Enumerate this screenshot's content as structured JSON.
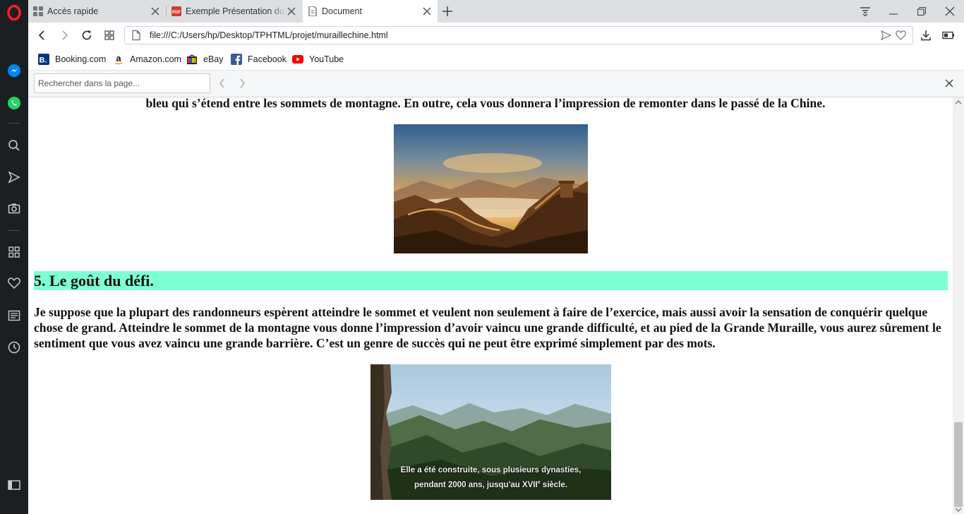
{
  "tabs": [
    {
      "title": "Accès rapide",
      "icon": "grid-icon"
    },
    {
      "title": "Exemple Présentation du p",
      "icon": "pdf-icon"
    },
    {
      "title": "Document",
      "icon": "document-icon",
      "active": true
    }
  ],
  "address": {
    "url": "file:///C:/Users/hp/Desktop/TPHTML/projet/muraillechine.html"
  },
  "bookmarks": [
    {
      "label": "Booking.com",
      "icon": "booking-icon",
      "color": "#003580"
    },
    {
      "label": "Amazon.com",
      "icon": "amazon-icon",
      "color": "#111111"
    },
    {
      "label": "eBay",
      "icon": "ebay-icon",
      "color": "#e53238"
    },
    {
      "label": "Facebook",
      "icon": "facebook-icon",
      "color": "#3b5998"
    },
    {
      "label": "YouTube",
      "icon": "youtube-icon",
      "color": "#ff0000"
    }
  ],
  "find": {
    "placeholder": "Rechercher dans la page..."
  },
  "sidebar": {
    "items": [
      "opera-logo-icon",
      "messenger-icon",
      "whatsapp-icon",
      "search-icon",
      "send-icon",
      "camera-icon",
      "speed-dial-icon",
      "heart-icon",
      "news-icon",
      "history-icon",
      "sidebar-toggle-icon"
    ]
  },
  "page": {
    "intro_text": "bleu qui s’étend entre les sommets de montagne. En outre, cela vous donnera l’impression de remonter dans le passé de la Chine.",
    "heading": "5. Le goût du défi.",
    "body_text": "Je suppose que la plupart des randonneurs espèrent atteindre le sommet et veulent non seulement à faire de l’exercice, mais aussi avoir la sensation de conquérir quelque chose de grand. Atteindre le sommet de la montagne vous donne l’impression d’avoir vaincu une grande difficulté, et au pied de la Grande Muraille, vous aurez sûrement le sentiment que vous avez vaincu une grande barrière. C’est un genre de succès qui ne peut être exprimé simplement par des mots.",
    "caption_line1": "Elle a été construite, sous plusieurs dynasties,",
    "caption_line2": "pendant 2000 ans, jusqu'au XVII",
    "caption_sup": "e",
    "caption_end": "siècle."
  },
  "colors": {
    "heading_bg": "#7fffd4",
    "sidebar_bg": "#1c1f21",
    "opera_red": "#ff1b2d"
  }
}
